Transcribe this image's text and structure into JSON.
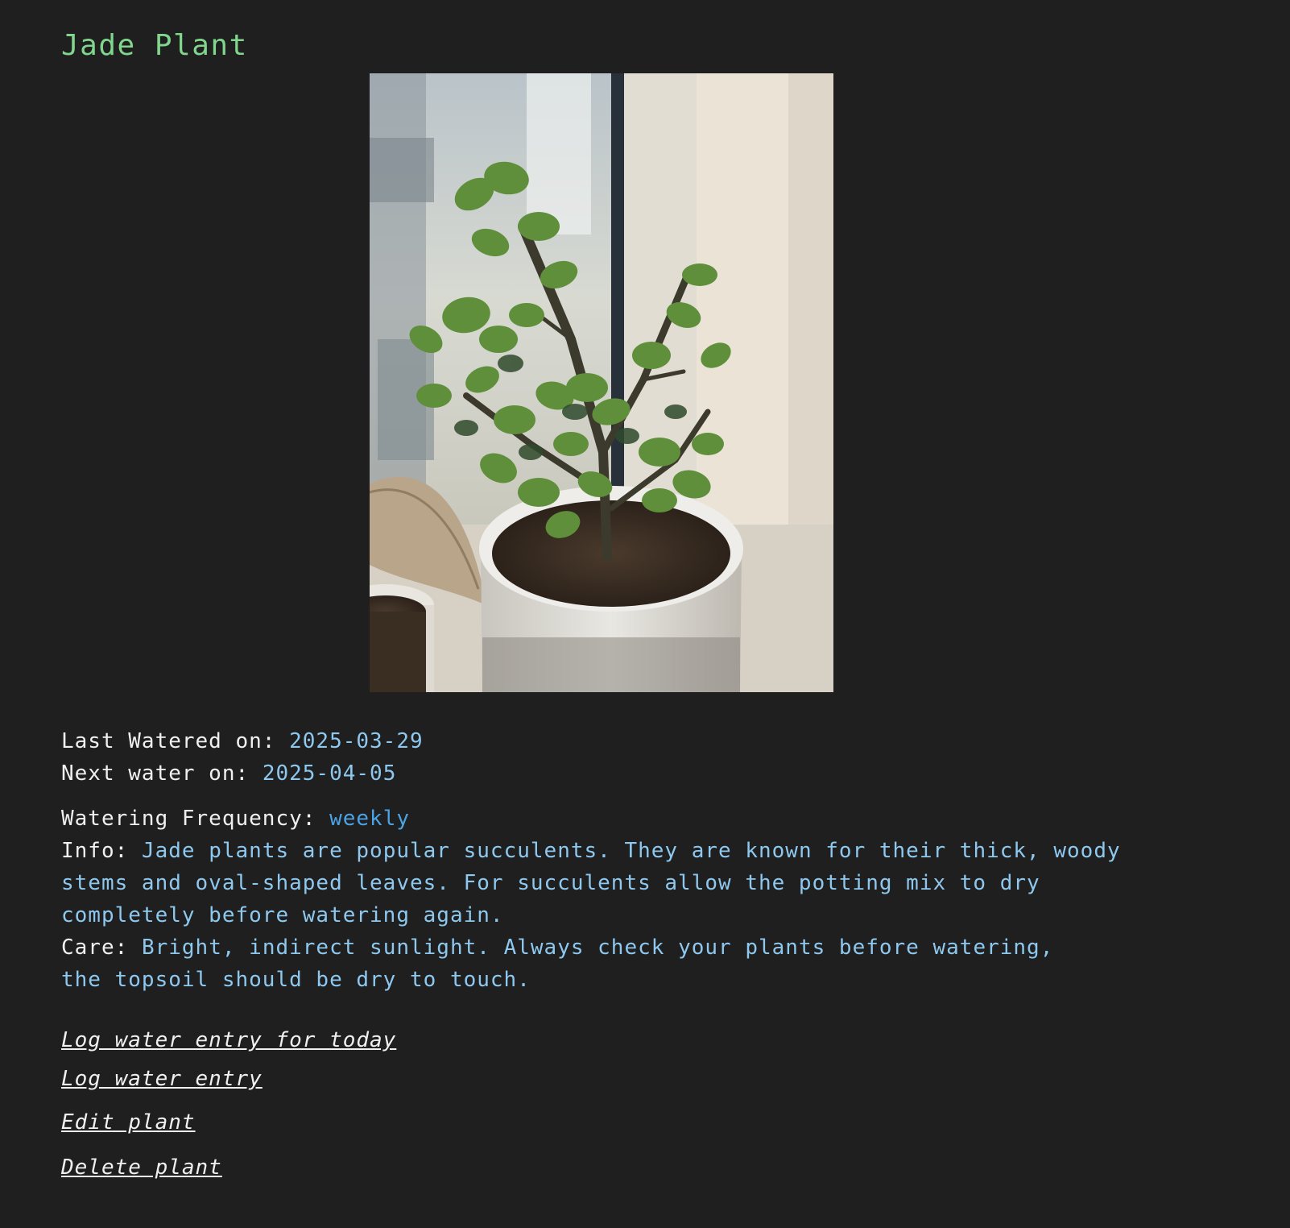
{
  "plant": {
    "name": "Jade Plant",
    "last_watered_label": "Last Watered on:",
    "last_watered": "2025-03-29",
    "next_water_label": "Next water on:",
    "next_water": "2025-04-05",
    "frequency_label": "Watering Frequency:",
    "frequency": "weekly",
    "info_label": "Info:",
    "info": "Jade plants are popular succulents. They are known for their thick, woody stems and oval-shaped leaves. For succulents allow the potting mix to dry completely before watering again.",
    "care_label": "Care:",
    "care": "Bright, indirect sunlight. Always check your plants before watering, the topsoil should be dry to touch."
  },
  "actions": {
    "log_today": "Log water entry for today",
    "log_entry": "Log water entry",
    "edit": "Edit plant",
    "delete": "Delete plant"
  },
  "colors": {
    "background": "#1f1f1f",
    "title": "#7fd68c",
    "value": "#8ec8ef",
    "frequency": "#4ba3e6",
    "text": "#f0f0f0"
  }
}
